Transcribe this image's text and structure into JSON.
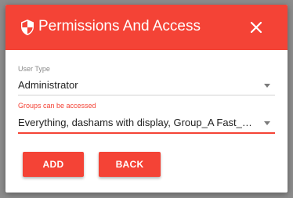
{
  "colors": {
    "accent": "#f44336",
    "overlay": "#8c8c8c"
  },
  "dialog": {
    "title": "Permissions And Access",
    "title_icon": "shield-icon",
    "close_icon": "close-icon"
  },
  "form": {
    "user_type": {
      "label": "User Type",
      "value": "Administrator"
    },
    "groups": {
      "label": "Groups can be accessed",
      "value": "Everything, dashams with display, Group_A Fast_C…"
    }
  },
  "actions": {
    "add_label": "ADD",
    "back_label": "BACK"
  }
}
